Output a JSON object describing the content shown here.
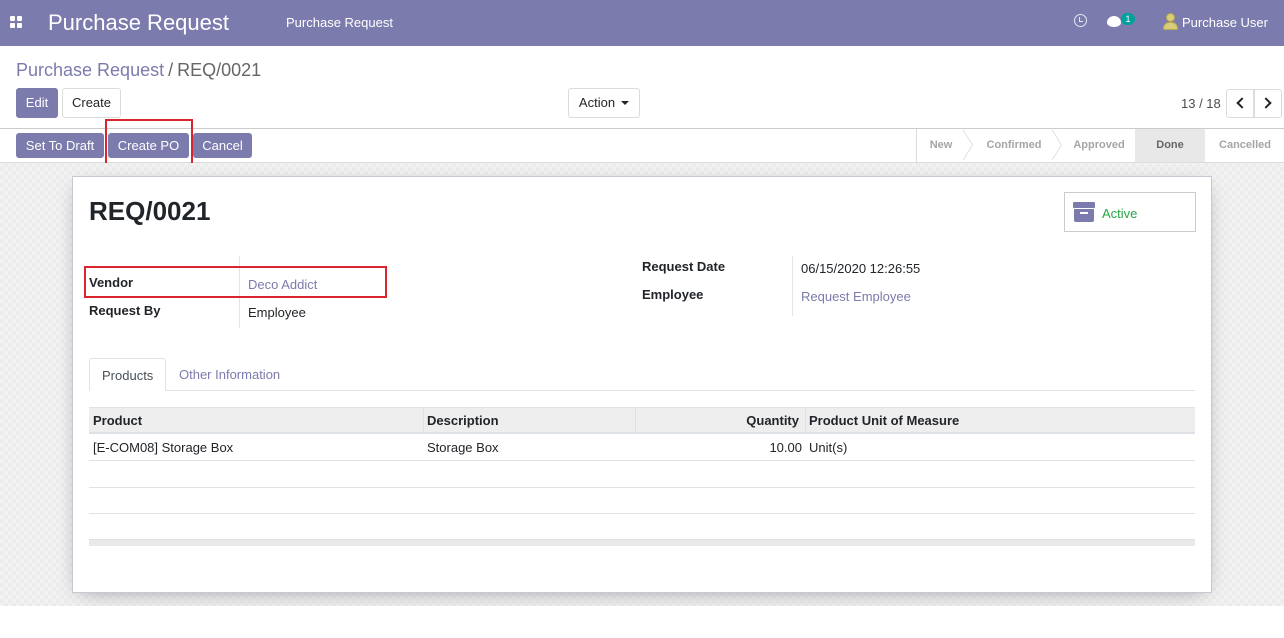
{
  "navbar": {
    "app_title": "Purchase Request",
    "menu_item": "Purchase Request",
    "message_count": "1",
    "user_name": "Purchase User",
    "icons": [
      "apps-icon",
      "clock-icon",
      "chat-icon",
      "user-avatar"
    ]
  },
  "breadcrumb": {
    "parent": "Purchase Request",
    "separator": "/",
    "current": "REQ/0021"
  },
  "toolbar": {
    "edit_label": "Edit",
    "create_label": "Create",
    "action_label": "Action",
    "pager_value": "13 / 18"
  },
  "statusbar": {
    "set_to_draft_label": "Set To Draft",
    "create_po_label": "Create PO",
    "cancel_label": "Cancel",
    "stages": [
      "New",
      "Confirmed",
      "Approved",
      "Done",
      "Cancelled"
    ],
    "current_stage": "Done"
  },
  "record": {
    "title": "REQ/0021",
    "active_label": "Active",
    "vendor_label": "Vendor",
    "vendor_value": "Deco Addict",
    "request_by_label": "Request By",
    "request_by_value": "Employee",
    "request_date_label": "Request Date",
    "request_date_value": "06/15/2020 12:26:55",
    "employee_label": "Employee",
    "employee_value": "Request Employee"
  },
  "tabs": {
    "products": "Products",
    "other_information": "Other Information"
  },
  "table": {
    "columns": [
      "Product",
      "Description",
      "Quantity",
      "Product Unit of Measure"
    ],
    "rows": [
      {
        "product": "[E-COM08] Storage Box",
        "description": "Storage Box",
        "quantity": "10.00",
        "uom": "Unit(s)"
      }
    ]
  },
  "colors": {
    "primary": "#7c7bad",
    "active_green": "#28a745",
    "highlight_red": "#d9262e"
  }
}
